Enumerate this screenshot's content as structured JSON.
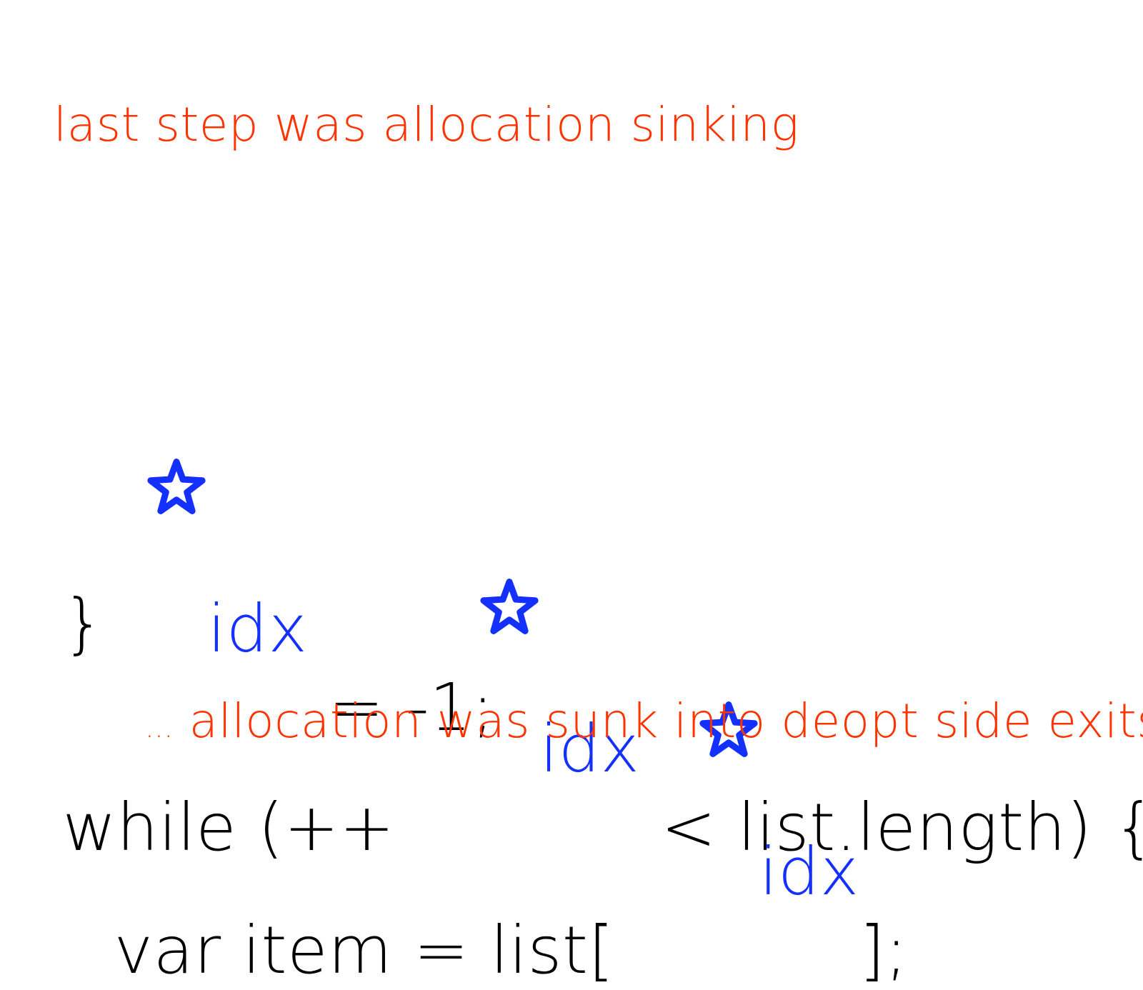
{
  "colors": {
    "accent": "#ff3300",
    "variable": "#1430ff",
    "code": "#000000",
    "background": "#ffffff"
  },
  "heading": {
    "plain": "last step was ",
    "highlight": "allocation sinking"
  },
  "code": {
    "variable_name": "idx",
    "star_icon": "star-icon",
    "line1_rest": " = -1;",
    "line2_prefix": "while (++",
    "line2_rest": " < list.length) {",
    "line3_prefix": "var item = list[",
    "line3_rest": "];",
    "line4": "}"
  },
  "footer": {
    "ellipsis": "...",
    "text": "allocation was sunk into deopt side exits"
  }
}
